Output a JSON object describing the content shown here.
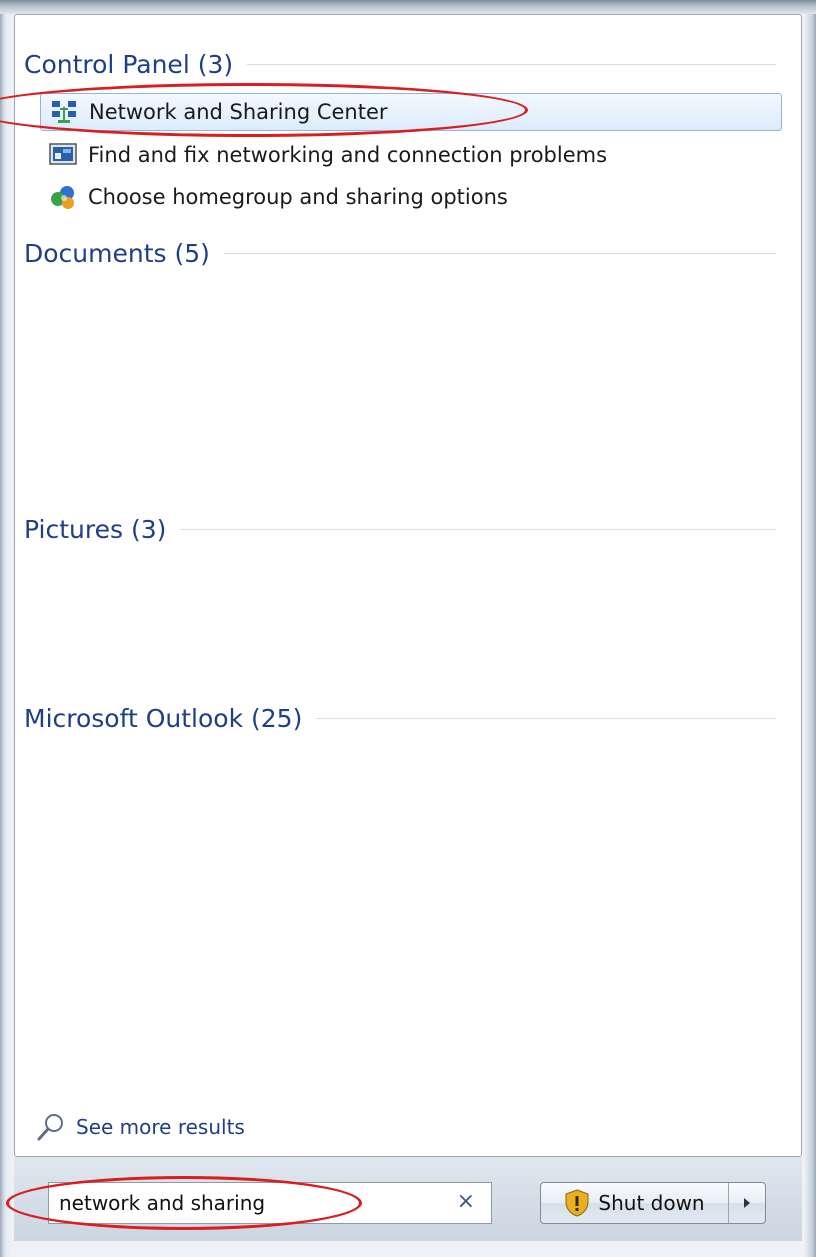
{
  "groups": {
    "control_panel": "Control Panel (3)",
    "documents": "Documents (5)",
    "pictures": "Pictures (3)",
    "outlook": "Microsoft Outlook (25)"
  },
  "control_panel_items": [
    {
      "label": "Network and Sharing Center",
      "icon": "network-icon"
    },
    {
      "label": "Find and fix networking and connection problems",
      "icon": "troubleshoot-icon"
    },
    {
      "label": "Choose homegroup and sharing options",
      "icon": "homegroup-icon"
    }
  ],
  "see_more": "See more results",
  "search": {
    "value": "network and sharing"
  },
  "shutdown": {
    "label": "Shut down"
  },
  "colors": {
    "accent": "#1e3f87",
    "annotation": "#d91e1e"
  }
}
